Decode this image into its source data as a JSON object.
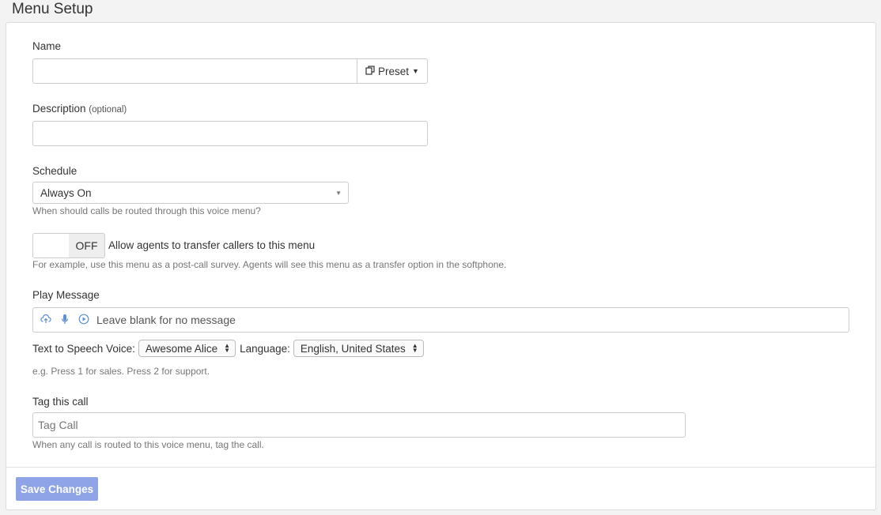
{
  "page": {
    "title": "Menu Setup"
  },
  "name": {
    "label": "Name",
    "value": "",
    "preset_label": "Preset"
  },
  "description": {
    "label": "Description",
    "optional": "(optional)",
    "value": ""
  },
  "schedule": {
    "label": "Schedule",
    "selected": "Always On",
    "help": "When should calls be routed through this voice menu?"
  },
  "transfer": {
    "state": "OFF",
    "label": "Allow agents to transfer callers to this menu",
    "help": "For example, use this menu as a post-call survey. Agents will see this menu as a transfer option in the softphone."
  },
  "play_message": {
    "label": "Play Message",
    "placeholder": "Leave blank for no message",
    "icons": [
      "upload-cloud-icon",
      "microphone-icon",
      "play-circle-icon"
    ]
  },
  "tts": {
    "voice_label": "Text to Speech Voice:",
    "voice_selected": "Awesome Alice",
    "language_label": "Language:",
    "language_selected": "English, United States",
    "help": "e.g. Press 1 for sales. Press 2 for support."
  },
  "tag": {
    "label": "Tag this call",
    "placeholder": "Tag Call",
    "help": "When any call is routed to this voice menu, tag the call."
  },
  "footer": {
    "save_label": "Save Changes"
  },
  "colors": {
    "accent": "#8ea4e6",
    "icon": "#5b8fd6"
  }
}
